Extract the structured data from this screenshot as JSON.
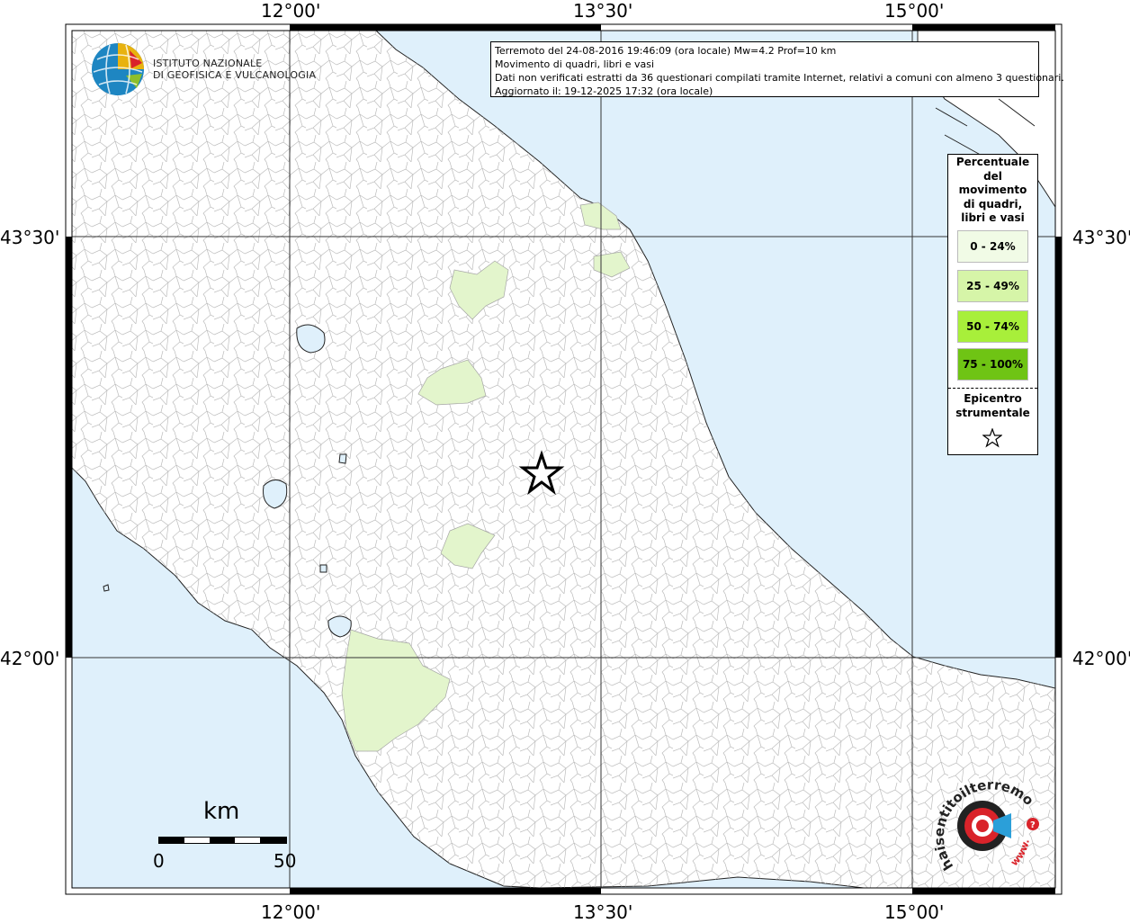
{
  "header": {
    "line1": "Terremoto del 24-08-2016 19:46:09 (ora locale) Mw=4.2 Prof=10 km",
    "line2": "Movimento di quadri, libri e vasi",
    "line3": "Dati non verificati estratti da 36 questionari compilati tramite Internet, relativi a comuni con almeno 3 questionari.",
    "line4": "Aggiornato il: 19-12-2025 17:32 (ora locale)"
  },
  "logo": {
    "line1": "ISTITUTO NAZIONALE",
    "line2": "DI GEOFISICA E VULCANOLOGIA"
  },
  "axes": {
    "lon_top": [
      "12°00'",
      "13°30'",
      "15°00'"
    ],
    "lon_bottom": [
      "12°00'",
      "13°30'",
      "15°00'"
    ],
    "lat_left": [
      "43°30'",
      "42°00'"
    ],
    "lat_right": [
      "43°30'",
      "42°00'"
    ]
  },
  "legend": {
    "title": [
      "Percentuale",
      "del",
      "movimento",
      "di quadri,",
      "libri e vasi"
    ],
    "classes": [
      {
        "label": "0 - 24%",
        "color": "#f1fbe6"
      },
      {
        "label": "25 - 49%",
        "color": "#d6f5a8"
      },
      {
        "label": "50 - 74%",
        "color": "#a8ef3a"
      },
      {
        "label": "75 - 100%",
        "color": "#6fc414"
      }
    ],
    "epicenter_label": [
      "Epicentro",
      "strumentale"
    ]
  },
  "scale": {
    "unit": "km",
    "min": "0",
    "max": "50"
  },
  "watermark": {
    "text": "haisentitoilterremoto.it",
    "url_text": "www."
  },
  "colors": {
    "sea": "#dff0fb",
    "land": "#ffffff",
    "class_low": "#f1fbe6",
    "class_25": "#e3f5cc"
  }
}
